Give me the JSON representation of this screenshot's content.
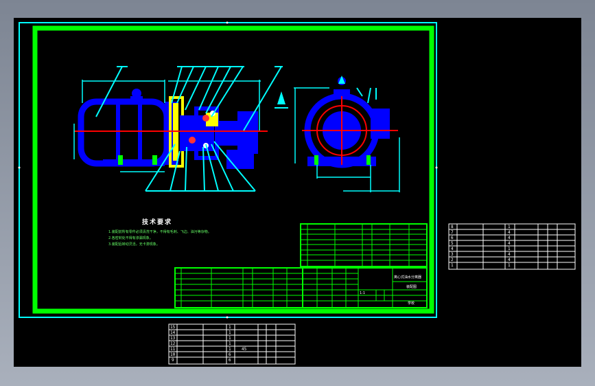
{
  "colors": {
    "background": "#9aa2ad",
    "sheet": "#000000",
    "frame_outer": "#00ffff",
    "frame_inner": "#00ff00",
    "part_fill": "#0000ff",
    "leader": "#00ffff",
    "center_line": "#ff0000",
    "accent": "#ffff00"
  },
  "notes": {
    "title": "技术要求",
    "lines": [
      "1.装配前所有零件必须清洗干净，不得有毛刺、飞边、油污等杂物。",
      "2.各密封处不得有渗漏现象。",
      "3.装配后转动灵活，无卡滞现象。"
    ]
  },
  "title_block": {
    "name": "离心式油水分离器",
    "drawing_label": "装配图",
    "sheet": "1:1",
    "company": "学校"
  },
  "bom_right": {
    "rows": [
      {
        "no": "8",
        "qty": "1"
      },
      {
        "no": "7",
        "qty": "4"
      },
      {
        "no": "6",
        "qty": "4"
      },
      {
        "no": "5",
        "qty": "4"
      },
      {
        "no": "4",
        "qty": "1"
      },
      {
        "no": "3",
        "qty": "4"
      },
      {
        "no": "2",
        "qty": "4"
      },
      {
        "no": "1",
        "qty": "1"
      }
    ]
  },
  "bom_bottom": {
    "rows": [
      {
        "no": "15",
        "qty": "1"
      },
      {
        "no": "14",
        "qty": "1"
      },
      {
        "no": "13",
        "qty": "1"
      },
      {
        "no": "12",
        "qty": "1"
      },
      {
        "no": "11",
        "qty": "1",
        "mat": "45"
      },
      {
        "no": "10",
        "qty": "6"
      },
      {
        "no": "9",
        "qty": "6"
      }
    ]
  }
}
